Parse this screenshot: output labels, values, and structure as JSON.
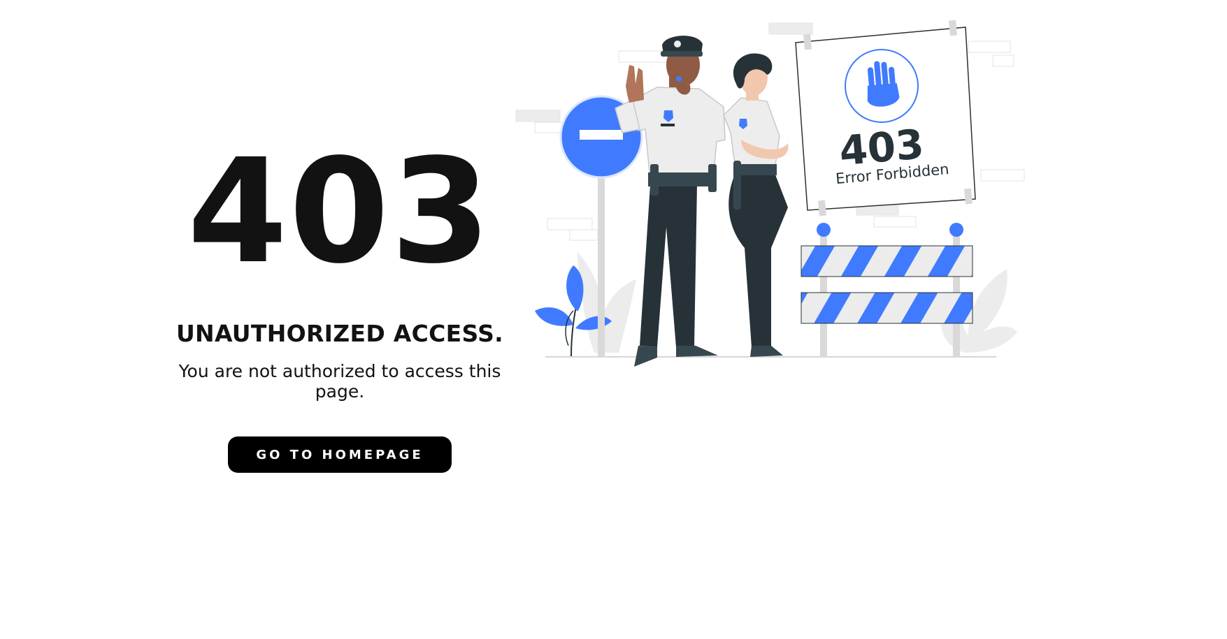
{
  "error": {
    "code": "403",
    "headline": "UNAUTHORIZED ACCESS.",
    "message": "You are not authorized to access this page."
  },
  "actions": {
    "home_label": "GO TO HOMEPAGE"
  },
  "illustration": {
    "sign_code": "403",
    "sign_text": "Error Forbidden"
  },
  "colors": {
    "accent": "#407BFF",
    "text": "#121212",
    "button_bg": "#000000",
    "uniform_dark": "#263238"
  }
}
